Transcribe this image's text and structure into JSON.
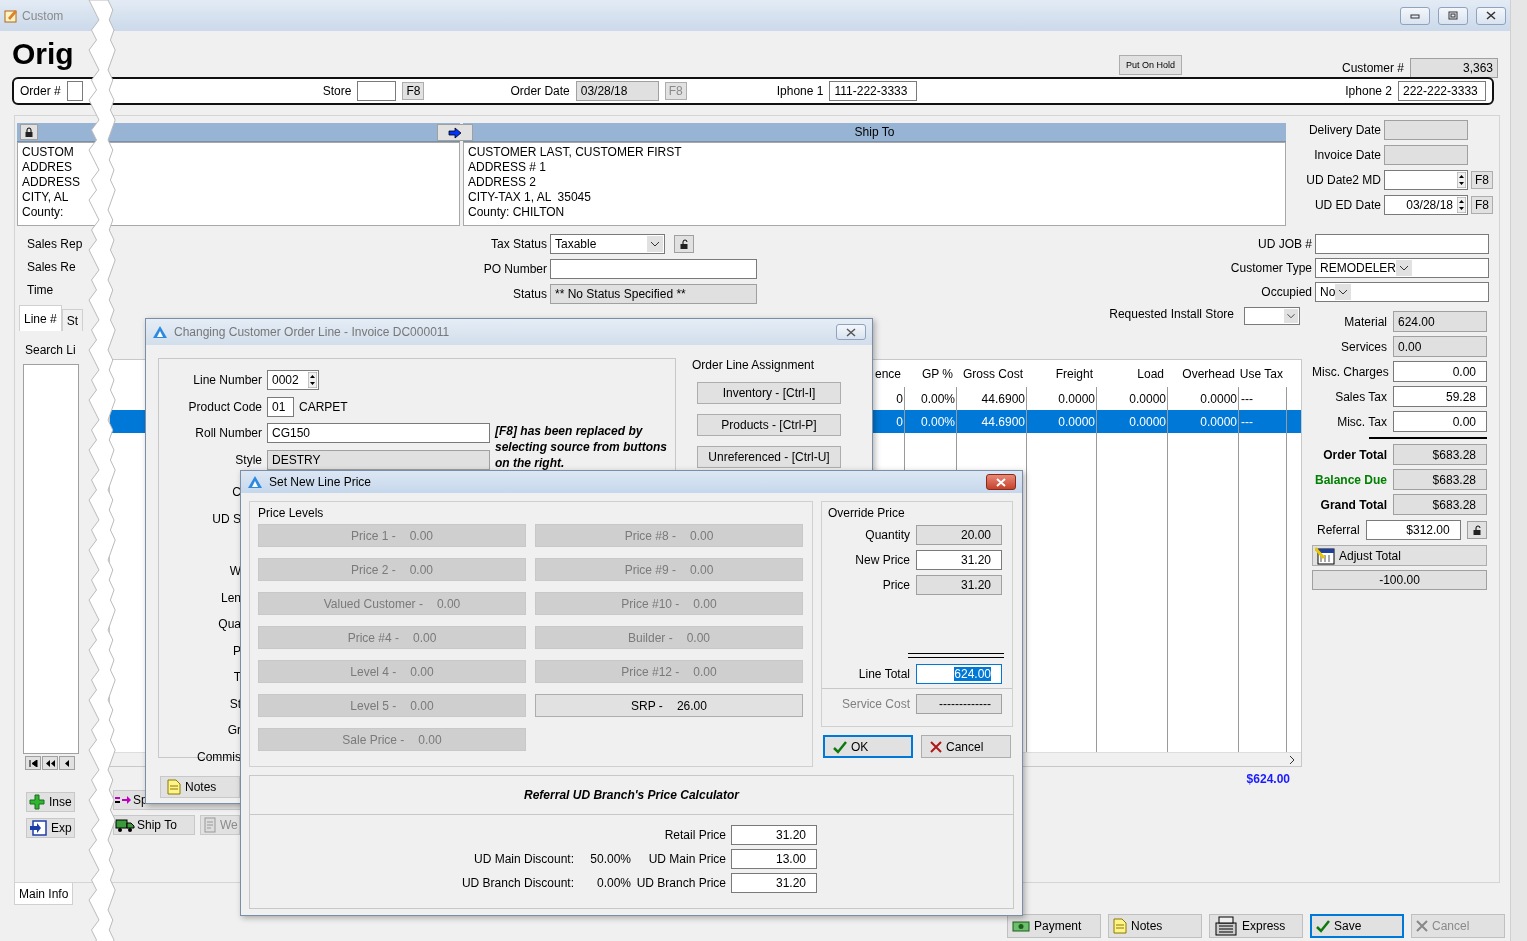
{
  "main_window": {
    "title": "Custom",
    "heading": "Orig"
  },
  "header": {
    "hold_button": "Put On Hold",
    "customer_label": "Customer #",
    "customer_value": "3,363"
  },
  "order_bar": {
    "order_label": "Order #",
    "store_label": "Store",
    "store_f8": {
      "label": "F8",
      "disabled": false
    },
    "date_label": "Order Date",
    "date_value": "03/28/18",
    "date_f8": {
      "label": "F8",
      "disabled": true
    },
    "phone1_label": "Iphone 1",
    "phone1": "111-222-3333",
    "phone2_label": "Iphone 2",
    "phone2": "222-222-3333"
  },
  "bill_to": {
    "lines": [
      "CUSTOM",
      "ADDRES",
      "ADDRESS",
      "CITY, AL",
      "County:"
    ]
  },
  "ship_to": {
    "title": "Ship To",
    "lines": [
      "CUSTOMER LAST, CUSTOMER FIRST",
      "ADDRESS # 1",
      "ADDRESS 2",
      "CITY-TAX 1, AL  35045",
      "County: CHILTON"
    ]
  },
  "dates": [
    {
      "label": "Delivery Date",
      "kind": "readonly"
    },
    {
      "label": "Invoice Date",
      "kind": "readonly"
    },
    {
      "label": "UD Date2 MD",
      "kind": "spin",
      "button": "F8"
    },
    {
      "label": "UD ED Date",
      "kind": "spin",
      "value": "03/28/18",
      "button": "F8"
    }
  ],
  "rep_labels": [
    "Sales Rep",
    "Sales Re",
    "Time"
  ],
  "order_fields": [
    {
      "label": "Tax Status",
      "kind": "combo",
      "value": "Taxable",
      "lock": true
    },
    {
      "label": "PO Number",
      "kind": "text"
    },
    {
      "label": "Status",
      "kind": "readonly",
      "value": "** No Status Specified **"
    }
  ],
  "customer_fields": [
    {
      "label": "UD JOB #",
      "kind": "text"
    },
    {
      "label": "Customer Type",
      "kind": "combo",
      "value": "REMODELER"
    },
    {
      "label": "Occupied",
      "kind": "combo",
      "value": "No"
    }
  ],
  "line_tabs": [
    {
      "label": "Line #",
      "selected": true
    },
    {
      "label": "St",
      "selected": false
    }
  ],
  "search_label": "Search Li",
  "install_store_label": "Requested Install Store",
  "table": {
    "columns": [
      "ence",
      "GP %",
      "Gross Cost",
      "Freight",
      "Load",
      "Overhead",
      "Use Tax"
    ],
    "rows": [
      {
        "selected": false,
        "cells": [
          "0",
          "0.00%",
          "44.6900",
          "0.0000",
          "0.0000",
          "0.0000",
          "---"
        ]
      },
      {
        "selected": true,
        "cells": [
          "0",
          "0.00%",
          "44.6900",
          "0.0000",
          "0.0000",
          "0.0000",
          "---"
        ]
      }
    ],
    "total": "$624.00"
  },
  "totals": [
    {
      "label": "Material",
      "value": "624.00",
      "kind": "readonly"
    },
    {
      "label": "Services",
      "value": "0.00",
      "kind": "readonly"
    },
    {
      "label": "Misc. Charges",
      "value": "0.00",
      "kind": "input"
    },
    {
      "label": "Sales Tax",
      "value": "59.28",
      "kind": "input"
    },
    {
      "label": "Misc. Tax",
      "value": "0.00",
      "kind": "input"
    },
    {
      "label": "Order Total",
      "value": "$683.28",
      "kind": "total"
    },
    {
      "label": "Balance Due",
      "value": "$683.28",
      "kind": "due"
    },
    {
      "label": "Grand Total",
      "value": "$683.28",
      "kind": "total"
    }
  ],
  "referral": {
    "label": "Referral",
    "value": "$312.00"
  },
  "adjust_total": {
    "label": "Adjust Total",
    "value": "-100.00"
  },
  "left_buttons": [
    {
      "label": "Inse",
      "kind": "insert"
    },
    {
      "label": "Exp",
      "kind": "export"
    }
  ],
  "mid_buttons": [
    {
      "label": "Sp",
      "kind": "split",
      "disabled": false
    },
    {
      "label": "Ship To",
      "kind": "ship",
      "disabled": false
    },
    {
      "label": "We",
      "kind": "web",
      "disabled": true
    }
  ],
  "main_tabs": [
    {
      "label": "Main Info",
      "selected": true
    }
  ],
  "bottom_buttons": [
    {
      "label": "Payment",
      "kind": "payment",
      "disabled": false,
      "focused": false
    },
    {
      "label": "Notes",
      "kind": "notes",
      "disabled": false,
      "focused": false
    },
    {
      "label": "Express",
      "kind": "express",
      "disabled": false,
      "focused": false
    },
    {
      "label": "Save",
      "kind": "save",
      "disabled": false,
      "focused": true
    },
    {
      "label": "Cancel",
      "kind": "cancel",
      "disabled": true,
      "focused": false
    }
  ],
  "line_dialog": {
    "title": "Changing Customer Order Line - Invoice DC000011",
    "fields": [
      {
        "label": "Line Number",
        "value": "0002",
        "kind": "spin"
      },
      {
        "label": "Product Code",
        "value": "01",
        "note": "CARPET",
        "kind": "code"
      },
      {
        "label": "Roll Number",
        "value": "CG150",
        "kind": "text"
      },
      {
        "label": "Style",
        "value": "DESTRY",
        "kind": "readonly"
      }
    ],
    "hint": "[F8] has been replaced by selecting source from buttons on the right.",
    "cut_labels": [
      "C",
      "UD S",
      "W",
      "Len",
      "Qua",
      "P",
      "T",
      "St",
      "Gr",
      "Commis"
    ],
    "assignment_title": "Order Line Assignment",
    "assignment_buttons": [
      "Inventory - [Ctrl-I]",
      "Products - [Ctrl-P]",
      "Unreferenced - [Ctrl-U]"
    ],
    "notes_button": "Notes"
  },
  "price_dialog": {
    "title": "Set New Line Price",
    "levels_title": "Price Levels",
    "levels": [
      {
        "label": "Price 1 -",
        "value": "0.00",
        "disabled": true
      },
      {
        "label": "Price #8 -",
        "value": "0.00",
        "disabled": true
      },
      {
        "label": "Price 2 -",
        "value": "0.00",
        "disabled": true
      },
      {
        "label": "Price #9 -",
        "value": "0.00",
        "disabled": true
      },
      {
        "label": "Valued Customer -",
        "value": "0.00",
        "disabled": true
      },
      {
        "label": "Price #10 -",
        "value": "0.00",
        "disabled": true
      },
      {
        "label": "Price #4 -",
        "value": "0.00",
        "disabled": true
      },
      {
        "label": "Builder -",
        "value": "0.00",
        "disabled": true
      },
      {
        "label": "Level 4 -",
        "value": "0.00",
        "disabled": true
      },
      {
        "label": "Price #12 -",
        "value": "0.00",
        "disabled": true
      },
      {
        "label": "Level 5 -",
        "value": "0.00",
        "disabled": true
      },
      {
        "label": "SRP -",
        "value": "26.00",
        "disabled": false
      },
      {
        "label": "Sale Price -",
        "value": "0.00",
        "disabled": true
      }
    ],
    "override_title": "Override Price",
    "override": [
      {
        "label": "Quantity",
        "value": "20.00",
        "kind": "readonly"
      },
      {
        "label": "New Price",
        "value": "31.20",
        "kind": "input"
      },
      {
        "label": "Price",
        "value": "31.20",
        "kind": "readonly"
      }
    ],
    "line_total": {
      "label": "Line Total",
      "value": "624.00"
    },
    "service_cost": {
      "label": "Service Cost",
      "value": "-------------"
    },
    "ok": "OK",
    "cancel": "Cancel"
  },
  "calculator": {
    "title": "Referral UD Branch's Price Calculator",
    "rows": [
      {
        "price_label": "Retail Price",
        "price": "31.20"
      },
      {
        "discount_label": "UD Main Discount:",
        "discount": "50.00%",
        "price_label": "UD Main Price",
        "price": "13.00"
      },
      {
        "discount_label": "UD Branch Discount:",
        "discount": "0.00%",
        "price_label": "UD Branch Price",
        "price": "31.20"
      }
    ]
  }
}
